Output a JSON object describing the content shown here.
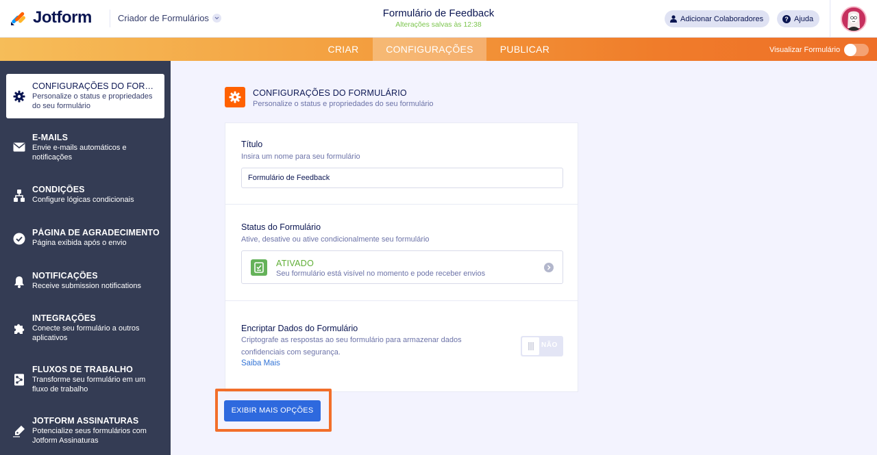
{
  "header": {
    "logo_text": "Jotform",
    "builder_label": "Criador de Formulários",
    "form_title": "Formulário de Feedback",
    "saved_status": "Alterações salvas às 12:38",
    "collaborators_label": "Adicionar Colaboradores",
    "help_label": "Ajuda"
  },
  "tabs": {
    "create": "CRIAR",
    "settings": "CONFIGURAÇÕES",
    "publish": "PUBLICAR",
    "active": "CONFIGURAÇÕES",
    "preview_label": "Visualizar Formulário",
    "preview_enabled": false
  },
  "sidebar": {
    "items": [
      {
        "title": "CONFIGURAÇÕES DO FORMULÁRIO",
        "desc": "Personalize o status e propriedades do seu formulário",
        "icon": "gear-icon",
        "active": true
      },
      {
        "title": "E-MAILS",
        "desc": "Envie e-mails automáticos e notificações",
        "icon": "envelope-icon"
      },
      {
        "title": "CONDIÇÕES",
        "desc": "Configure lógicas condicionais",
        "icon": "conditions-icon"
      },
      {
        "title": "PÁGINA DE AGRADECIMENTO",
        "desc": "Página exibida após o envio",
        "icon": "check-circle-icon"
      },
      {
        "title": "NOTIFICAÇÕES",
        "desc": "Receive submission notifications",
        "icon": "bell-icon"
      },
      {
        "title": "INTEGRAÇÕES",
        "desc": "Conecte seu formulário a outros aplicativos",
        "icon": "puzzle-icon"
      },
      {
        "title": "FLUXOS DE TRABALHO",
        "desc": "Transforme seu formulário em um fluxo de trabalho",
        "icon": "workflow-icon"
      },
      {
        "title": "JOTFORM ASSINATURAS",
        "desc": "Potencialize seus formulários com Jotform Assinaturas",
        "icon": "signature-icon"
      }
    ]
  },
  "main": {
    "section_title": "CONFIGURAÇÕES DO FORMULÁRIO",
    "section_desc": "Personalize o status e propriedades do seu formulário",
    "title_label": "Título",
    "title_help": "Insira um nome para seu formulário",
    "title_value": "Formulário de Feedback",
    "status_label": "Status do Formulário",
    "status_help": "Ative, desative ou ative condicionalmente seu formulário",
    "status_name": "ATIVADO",
    "status_desc": "Seu formulário está visível no momento e pode receber envios",
    "encrypt_label": "Encriptar Dados do Formulário",
    "encrypt_help": "Criptografe as respostas ao seu formulário para armazenar dados confidenciais com segurança.",
    "encrypt_toggle": "NÃO",
    "learn_more": "Saiba Mais",
    "more_options_button": "EXIBIR MAIS OPÇÕES"
  },
  "colors": {
    "brand_orange": "#ff6100",
    "sidebar_bg": "#343c54",
    "primary_button": "#2e69de",
    "status_green": "#64b259",
    "highlight_border": "#f26e2a"
  }
}
